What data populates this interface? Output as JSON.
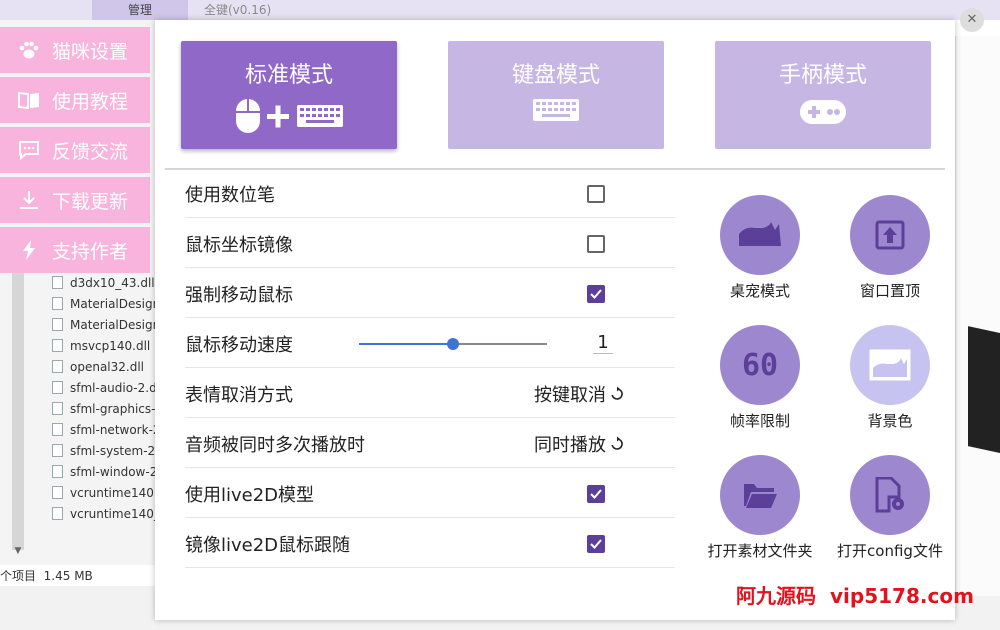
{
  "background_window": {
    "tab_label": "管理",
    "title": "全键(v0.16)",
    "close_glyph": "✕",
    "files": [
      "d3dx10_43.dll",
      "MaterialDesign",
      "MaterialDesign",
      "msvcp140.dll",
      "openal32.dll",
      "sfml-audio-2.d",
      "sfml-graphics-",
      "sfml-network-2",
      "sfml-system-2.",
      "sfml-window-2",
      "vcruntime140.c",
      "vcruntime140_1"
    ],
    "status_count": "个项目",
    "status_size": "1.45 MB"
  },
  "side_menu": [
    {
      "label": "猫咪设置",
      "icon": "paw-icon"
    },
    {
      "label": "使用教程",
      "icon": "book-icon"
    },
    {
      "label": "反馈交流",
      "icon": "chat-icon"
    },
    {
      "label": "下载更新",
      "icon": "download-icon"
    },
    {
      "label": "支持作者",
      "icon": "lightning-icon"
    }
  ],
  "modes": [
    {
      "label": "标准模式",
      "icon": "mouse-plus-keyboard-icon",
      "selected": true
    },
    {
      "label": "键盘模式",
      "icon": "keyboard-icon",
      "selected": false
    },
    {
      "label": "手柄模式",
      "icon": "gamepad-icon",
      "selected": false
    }
  ],
  "settings": {
    "pen": {
      "label": "使用数位笔",
      "checked": false
    },
    "mirror": {
      "label": "鼠标坐标镜像",
      "checked": false
    },
    "force_move": {
      "label": "强制移动鼠标",
      "checked": true
    },
    "speed": {
      "label": "鼠标移动速度",
      "value": "1",
      "slider_fraction": 0.5
    },
    "emote_cancel": {
      "label": "表情取消方式",
      "value": "按键取消"
    },
    "audio": {
      "label": "音频被同时多次播放时",
      "value": "同时播放"
    },
    "live2d": {
      "label": "使用live2D模型",
      "checked": true
    },
    "live2d_mirror": {
      "label": "镜像live2D鼠标跟随",
      "checked": true
    }
  },
  "circle_buttons": [
    {
      "label": "桌宠模式",
      "icon": "cat-silhouette-icon"
    },
    {
      "label": "窗口置顶",
      "icon": "pin-top-icon"
    },
    {
      "label": "帧率限制",
      "icon": "fps-60-icon",
      "icon_text": "60"
    },
    {
      "label": "背景色",
      "icon": "background-color-icon"
    },
    {
      "label": "打开素材文件夹",
      "icon": "folder-open-icon"
    },
    {
      "label": "打开config文件",
      "icon": "config-file-icon"
    }
  ],
  "watermark": {
    "part1": "阿九源码",
    "part2": "vip5178.com"
  },
  "colors": {
    "accent_purple": "#9068c8",
    "mode_inactive": "#c6b6e4",
    "side_pink": "#f8b4dc",
    "checkbox_on": "#5b3f98",
    "slider_blue": "#3d75d6",
    "circle_dark": "#9d87cf",
    "circle_light": "#c7c3f1",
    "watermark_red": "#e0141f"
  }
}
